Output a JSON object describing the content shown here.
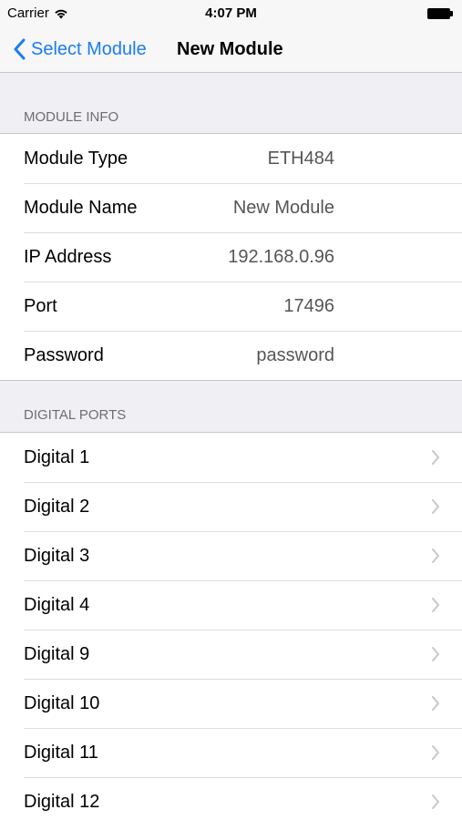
{
  "status_bar": {
    "carrier": "Carrier",
    "time": "4:07 PM"
  },
  "nav": {
    "back_label": "Select Module",
    "title": "New Module"
  },
  "module_info": {
    "header": "MODULE INFO",
    "rows": [
      {
        "label": "Module Type",
        "value": "ETH484"
      },
      {
        "label": "Module Name",
        "value": "New Module"
      },
      {
        "label": "IP Address",
        "value": "192.168.0.96"
      },
      {
        "label": "Port",
        "value": "17496"
      },
      {
        "label": "Password",
        "value": "password"
      }
    ]
  },
  "digital_ports": {
    "header": "DIGITAL PORTS",
    "rows": [
      {
        "label": "Digital 1"
      },
      {
        "label": "Digital 2"
      },
      {
        "label": "Digital 3"
      },
      {
        "label": "Digital 4"
      },
      {
        "label": "Digital 9"
      },
      {
        "label": "Digital 10"
      },
      {
        "label": "Digital 11"
      },
      {
        "label": "Digital 12"
      }
    ]
  },
  "colors": {
    "accent": "#1a7cf5",
    "background": "#efeff4",
    "section_header": "#6d6d72"
  }
}
